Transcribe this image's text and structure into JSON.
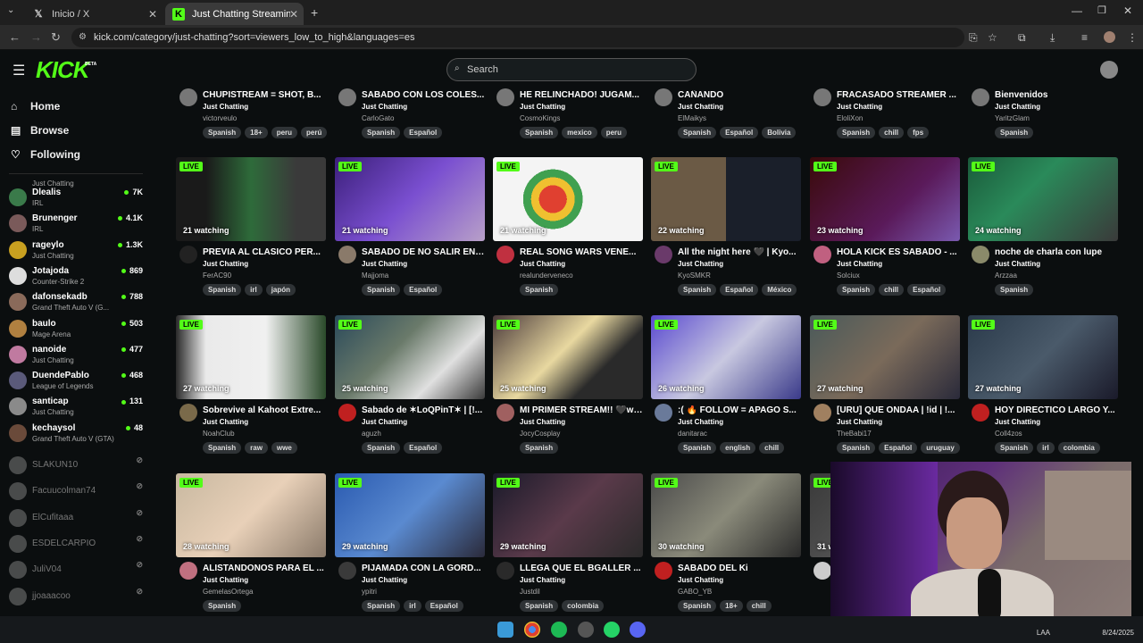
{
  "browser": {
    "tabs": [
      {
        "title": "Inicio / X"
      },
      {
        "title": "Just Chatting Streaming - Live"
      }
    ],
    "url": "kick.com/category/just-chatting?sort=viewers_low_to_high&languages=es"
  },
  "header": {
    "logo": "KICK",
    "beta": "BETA",
    "search_placeholder": "Search"
  },
  "sidebar": {
    "nav": [
      {
        "label": "Home"
      },
      {
        "label": "Browse"
      },
      {
        "label": "Following"
      }
    ],
    "following": [
      {
        "name": "",
        "category": "Just Chatting",
        "viewers": "",
        "color": "#6a6a8a"
      },
      {
        "name": "Dlealis",
        "category": "IRL",
        "viewers": "7K",
        "color": "#3a7a4a"
      },
      {
        "name": "Brunenger",
        "category": "IRL",
        "viewers": "4.1K",
        "color": "#7a5a5a"
      },
      {
        "name": "rageylo",
        "category": "Just Chatting",
        "viewers": "1.3K",
        "color": "#c8a020"
      },
      {
        "name": "Jotajoda",
        "category": "Counter-Strike 2",
        "viewers": "869",
        "color": "#ddd"
      },
      {
        "name": "dafonsekadb",
        "category": "Grand Theft Auto V (G...",
        "viewers": "788",
        "color": "#8a6a5a"
      },
      {
        "name": "baulo",
        "category": "Mage Arena",
        "viewers": "503",
        "color": "#b08040"
      },
      {
        "name": "nanoide",
        "category": "Just Chatting",
        "viewers": "477",
        "color": "#c07aa0"
      },
      {
        "name": "DuendePablo",
        "category": "League of Legends",
        "viewers": "468",
        "color": "#5a5a7a"
      },
      {
        "name": "santicap",
        "category": "Just Chatting",
        "viewers": "131",
        "color": "#8a8a8a"
      },
      {
        "name": "kechaysol",
        "category": "Grand Theft Auto V (GTA)",
        "viewers": "48",
        "color": "#6a4a3a"
      }
    ],
    "offline": [
      {
        "name": "SLAKUN10"
      },
      {
        "name": "Facuucolman74"
      },
      {
        "name": "ElCufitaaa"
      },
      {
        "name": "ESDELCARPIO"
      },
      {
        "name": "JuliV04"
      },
      {
        "name": "jjoaaacoo"
      }
    ]
  },
  "top_row": [
    {
      "title": "CHUPISTREAM = SHOT, B...",
      "category": "Just Chatting",
      "user": "victorveulo",
      "tags": [
        "Spanish",
        "18+",
        "peru",
        "perú"
      ]
    },
    {
      "title": "SABADO CON LOS COLES...",
      "category": "Just Chatting",
      "user": "CarloGato",
      "tags": [
        "Spanish",
        "Español"
      ]
    },
    {
      "title": "HE RELINCHADO! JUGAM...",
      "category": "Just Chatting",
      "user": "CosmoKings",
      "tags": [
        "Spanish",
        "mexico",
        "peru"
      ]
    },
    {
      "title": "CAÑANDO",
      "category": "Just Chatting",
      "user": "ElMaikys",
      "tags": [
        "Spanish",
        "Español",
        "Bolivia"
      ]
    },
    {
      "title": "FRACASADO STREAMER ...",
      "category": "Just Chatting",
      "user": "EloliXon",
      "tags": [
        "Spanish",
        "chill",
        "fps"
      ]
    },
    {
      "title": "Bienvenidos",
      "category": "Just Chatting",
      "user": "YaritzGlam",
      "tags": [
        "Spanish"
      ]
    }
  ],
  "rows": [
    [
      {
        "live": "LIVE",
        "watching": "21 watching",
        "title": "PREVIA AL CLASICO PER...",
        "category": "Just Chatting",
        "user": "FerAC90",
        "tags": [
          "Spanish",
          "irl",
          "japón"
        ],
        "bg": "linear-gradient(90deg,#1a1a1a 20%,#2e6b3a 50%,#3a3a3a 80%)",
        "av": "#222"
      },
      {
        "live": "LIVE",
        "watching": "21 watching",
        "title": "SABADO DE NO SALIR EN ...",
        "category": "Just Chatting",
        "user": "Majjoma",
        "tags": [
          "Spanish",
          "Español"
        ],
        "bg": "linear-gradient(135deg,#3b1f7a,#7a4fd0 50%,#b8a0c8)",
        "av": "#8a7a6a"
      },
      {
        "live": "LIVE",
        "watching": "21 watching",
        "title": "REAL SONG WARS VENE...",
        "category": "Just Chatting",
        "user": "realunderveneco",
        "tags": [
          "Spanish"
        ],
        "bg": "radial-gradient(circle at 40% 50%,#e04030 0 14%,#f0c030 14% 22%,#40a050 22% 30%,#f4f4f4 30%)",
        "av": "#c03040"
      },
      {
        "live": "LIVE",
        "watching": "22 watching",
        "title": "All the night here 🖤 | Kyo...",
        "category": "Just Chatting",
        "user": "KyoSMKR",
        "tags": [
          "Spanish",
          "Español",
          "México"
        ],
        "bg": "linear-gradient(90deg,#6b5a45 50%,#1a1f2a 50%)",
        "av": "#6a3a6a"
      },
      {
        "live": "LIVE",
        "watching": "23 watching",
        "title": "HOLA KICK ES SABADO - ...",
        "category": "Just Chatting",
        "user": "Solciux",
        "tags": [
          "Spanish",
          "chill",
          "Español"
        ],
        "bg": "linear-gradient(135deg,#3a0a0a,#5a1a5a 60%,#7a5ab0)",
        "av": "#c06080"
      },
      {
        "live": "LIVE",
        "watching": "24 watching",
        "title": "noche de charla con lupe",
        "category": "Just Chatting",
        "user": "Arzzaa",
        "tags": [
          "Spanish"
        ],
        "bg": "linear-gradient(135deg,#1a5a3a,#2a8a5a 40%,#3a3a3a)",
        "av": "#8a8a6a"
      }
    ],
    [
      {
        "live": "LIVE",
        "watching": "27 watching",
        "title": "Sobrevive al Kahoot Extre...",
        "category": "Just Chatting",
        "user": "NoahClub",
        "tags": [
          "Spanish",
          "raw",
          "wwe"
        ],
        "bg": "linear-gradient(90deg,#2a2a2a,#eaeaea 20%,#f0f0f0 60%,#2a4a2a)",
        "av": "#7a6a4a"
      },
      {
        "live": "LIVE",
        "watching": "25 watching",
        "title": "Sabado de ✶LoQPinT✶ | [!...",
        "category": "Just Chatting",
        "user": "aguzh",
        "tags": [
          "Spanish",
          "Español"
        ],
        "bg": "linear-gradient(135deg,#2a4a5a,#6a7a6a 40%,#e0e0e0 70%,#3a3a3a)",
        "av": "#c02020"
      },
      {
        "live": "LIVE",
        "watching": "25 watching",
        "title": "MI PRIMER STREAM!! 🖤w🖤",
        "category": "Just Chatting",
        "user": "JocyCosplay",
        "tags": [
          "Spanish"
        ],
        "bg": "linear-gradient(135deg,#4a3a3a,#e8d8a0 45%,#2a2a2a 70%)",
        "av": "#a06060"
      },
      {
        "live": "LIVE",
        "watching": "26 watching",
        "title": ":( 🔥 FOLLOW = APAGO S...",
        "category": "Just Chatting",
        "user": "danitarac",
        "tags": [
          "Spanish",
          "english",
          "chill"
        ],
        "bg": "linear-gradient(135deg,#5a4ad0,#c8c8e0 50%,#3a3a8a)",
        "av": "#6a7a9a"
      },
      {
        "live": "LIVE",
        "watching": "27 watching",
        "title": "[URU] QUE ONDAA | !id | !...",
        "category": "Just Chatting",
        "user": "TheBabi17",
        "tags": [
          "Spanish",
          "Español",
          "uruguay"
        ],
        "bg": "linear-gradient(135deg,#4a5a5a,#7a6a5a 50%,#2a2a3a)",
        "av": "#a08060"
      },
      {
        "live": "LIVE",
        "watching": "27 watching",
        "title": "HOY DIRECTICO LARGO Y...",
        "category": "Just Chatting",
        "user": "Coll4zos",
        "tags": [
          "Spanish",
          "irl",
          "colombia"
        ],
        "bg": "linear-gradient(135deg,#2a3a4a,#4a5a6a 50%,#1a1a2a)",
        "av": "#c02020"
      }
    ],
    [
      {
        "live": "LIVE",
        "watching": "28 watching",
        "title": "ALISTANDONOS PARA EL ...",
        "category": "Just Chatting",
        "user": "GemelasOrtega",
        "tags": [
          "Spanish"
        ],
        "bg": "linear-gradient(135deg,#c8b8a0,#e8d0b8 50%,#8a7a6a)",
        "av": "#c07080"
      },
      {
        "live": "LIVE",
        "watching": "29 watching",
        "title": "PIJAMADA CON LA GORD...",
        "category": "Just Chatting",
        "user": "ypitri",
        "tags": [
          "Spanish",
          "irl",
          "Español"
        ],
        "bg": "linear-gradient(135deg,#2a5ab0,#5a8ad0 50%,#2a2a3a)",
        "av": "#3a3a3a"
      },
      {
        "live": "LIVE",
        "watching": "29 watching",
        "title": "LLEGA QUE EL BGALLER ...",
        "category": "Just Chatting",
        "user": "Justdil",
        "tags": [
          "Spanish",
          "colombia"
        ],
        "bg": "linear-gradient(135deg,#1a1a2a,#5a3a4a 50%,#2a2a2a)",
        "av": "#2a2a2a"
      },
      {
        "live": "LIVE",
        "watching": "30 watching",
        "title": "SABADO DEL Ki",
        "category": "Just Chatting",
        "user": "GABO_YB",
        "tags": [
          "Spanish",
          "18+",
          "chill"
        ],
        "bg": "linear-gradient(135deg,#4a4a4a,#8a8a7a 50%,#2a2a2a)",
        "av": "#c02020"
      },
      {
        "live": "LIVE",
        "watching": "31 w",
        "title": "",
        "category": "",
        "user": "",
        "tags": [],
        "bg": "linear-gradient(135deg,#3a3a3a,#6a6a6a)",
        "av": "#ccc"
      }
    ]
  ],
  "taskbar": {
    "time": "",
    "date": "8/24/2025",
    "lang": "LAA"
  }
}
